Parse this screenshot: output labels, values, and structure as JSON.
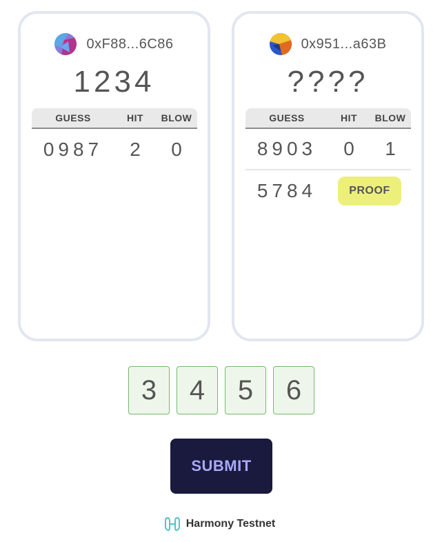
{
  "players": [
    {
      "address": "0xF88...6C86",
      "secret": "1234",
      "avatar_colors": [
        "#5aa9e6",
        "#b0358c",
        "#8b7ad8"
      ],
      "headers": {
        "guess": "GUESS",
        "hit": "HIT",
        "blow": "BLOW"
      },
      "rows": [
        {
          "guess": "0987",
          "hit": "2",
          "blow": "0"
        }
      ]
    },
    {
      "address": "0x951...a63B",
      "secret": "????",
      "avatar_colors": [
        "#f2c230",
        "#2b57c8",
        "#e06a1e"
      ],
      "headers": {
        "guess": "GUESS",
        "hit": "HIT",
        "blow": "BLOW"
      },
      "rows": [
        {
          "guess": "8903",
          "hit": "0",
          "blow": "1"
        }
      ],
      "pending": {
        "guess": "5784",
        "action_label": "PROOF"
      }
    }
  ],
  "input": {
    "digits": [
      "3",
      "4",
      "5",
      "6"
    ]
  },
  "submit_label": "SUBMIT",
  "network": {
    "name": "Harmony Testnet",
    "icon": "harmony-icon"
  },
  "colors": {
    "card_border": "#e1e6f0",
    "proof_bg": "#ecf07a",
    "submit_bg": "#1a1a3f",
    "submit_text": "#a8aaf7",
    "digit_border": "#73b86d",
    "digit_bg": "#eef6ec"
  }
}
